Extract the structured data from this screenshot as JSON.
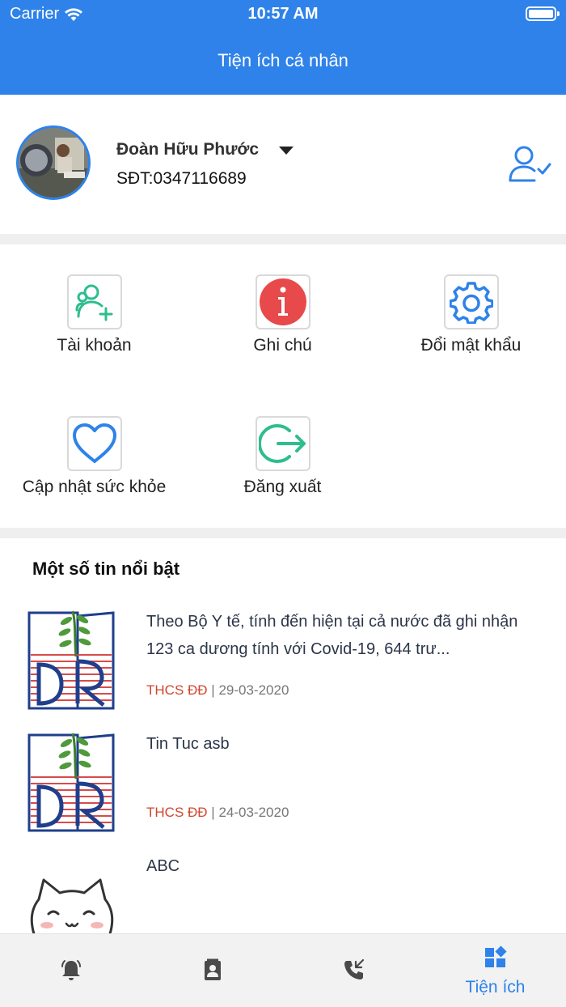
{
  "status_bar": {
    "carrier": "Carrier",
    "time": "10:57 AM"
  },
  "header": {
    "title": "Tiện ích cá nhân"
  },
  "profile": {
    "name": "Đoàn Hữu Phước",
    "phone": "SĐT:0347116689",
    "avatar_icon": "user-photo",
    "action_icon": "user-check-icon"
  },
  "menu": [
    {
      "label": "Tài khoản",
      "icon": "add-user-icon",
      "color": "#2ebd8f"
    },
    {
      "label": "Ghi chú",
      "icon": "info-icon",
      "color": "#e8494a"
    },
    {
      "label": "Đổi mật khẩu",
      "icon": "gear-icon",
      "color": "#2e82ea"
    },
    {
      "label": "Cập nhật sức khỏe",
      "icon": "heart-icon",
      "color": "#2e82ea"
    },
    {
      "label": "Đăng xuất",
      "icon": "logout-icon",
      "color": "#2ebd8f"
    }
  ],
  "news": {
    "heading": "Một số tin nổi bật",
    "items": [
      {
        "title": "Theo Bộ Y tế, tính đến hiện tại cả nước đã ghi nhận 123 ca dương tính với Covid-19, 644 trư...",
        "source": "THCS ĐĐ",
        "separator": "|",
        "date": "29-03-2020",
        "thumb": "school-logo"
      },
      {
        "title": "Tin Tuc asb",
        "source": "THCS ĐĐ",
        "separator": "|",
        "date": "24-03-2020",
        "thumb": "school-logo"
      },
      {
        "title": "ABC",
        "source": "",
        "separator": "",
        "date": "",
        "thumb": "cat-sticker"
      }
    ]
  },
  "tabbar": {
    "tabs": [
      {
        "label": "",
        "icon": "bell-icon"
      },
      {
        "label": "",
        "icon": "contacts-icon"
      },
      {
        "label": "",
        "icon": "phone-icon"
      },
      {
        "label": "Tiện ích",
        "icon": "widgets-icon",
        "active": true
      }
    ],
    "active_color": "#2e82ea",
    "inactive_color": "#4a4a4a"
  },
  "colors": {
    "primary": "#2e82ea",
    "accent_red": "#d2452f"
  }
}
